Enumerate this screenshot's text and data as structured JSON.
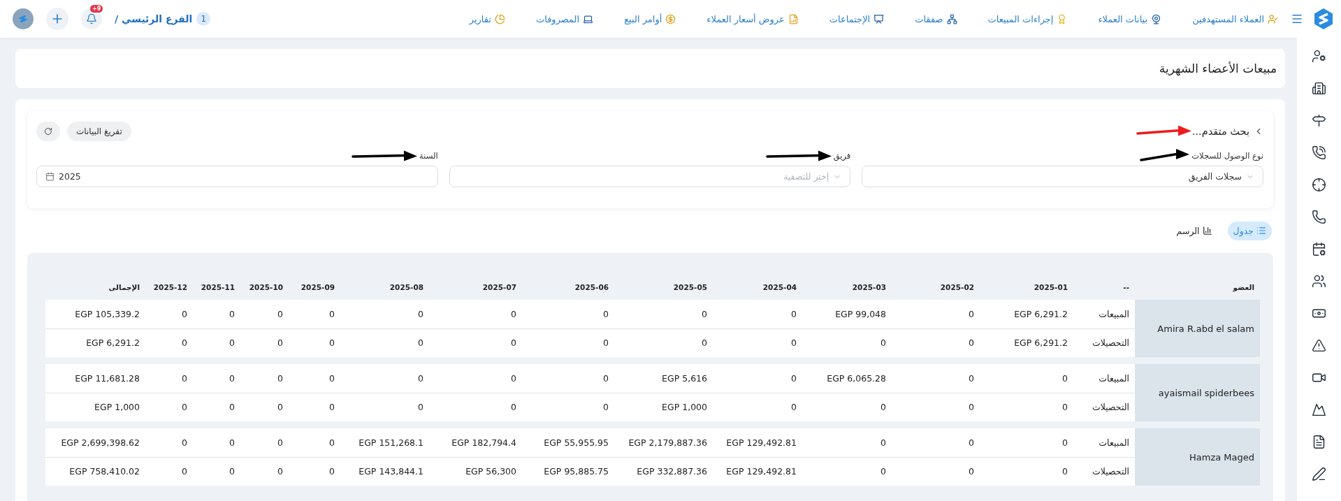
{
  "topbar": {
    "nav": [
      {
        "label": "العملاء المستهدفين"
      },
      {
        "label": "بيانات العملاء"
      },
      {
        "label": "إجراءات المبيعات"
      },
      {
        "label": "صفقات"
      },
      {
        "label": "الإجتماعات"
      },
      {
        "label": "عروض أسعار العملاء"
      },
      {
        "label": "أوامر البيع"
      },
      {
        "label": "المصروفات"
      },
      {
        "label": "تقارير"
      }
    ],
    "branch": {
      "number": "1",
      "name": "الفرع الرئيسي /"
    },
    "notifications": {
      "badge": "+9"
    }
  },
  "page_title": "مبيعات الأعضاء الشهرية",
  "filters": {
    "toggle_label": "بحث متقدم...",
    "toggle_arrow": {
      "color": "#ee1c1c"
    },
    "buttons": [
      {
        "kind": "text",
        "label": "تفريغ البيانات"
      },
      {
        "kind": "refresh"
      }
    ],
    "fields": [
      {
        "kind": "select",
        "label": "نوع الوصول للسجلات",
        "value": "سجلات الفريق",
        "arrow": {
          "color": "#000000"
        }
      },
      {
        "kind": "select",
        "label": "فريق",
        "placeholder": "إختر للتصفية",
        "arrow": {
          "color": "#000000"
        }
      },
      {
        "kind": "date",
        "label": "السنة",
        "value": "2025",
        "arrow": {
          "color": "#000000"
        }
      }
    ]
  },
  "views": [
    {
      "kind": "table",
      "label": "جدول",
      "selected": true
    },
    {
      "kind": "chart",
      "label": "الرسم",
      "selected": false
    }
  ],
  "table": {
    "columns": [
      "العضو",
      "--",
      "2025-01",
      "2025-02",
      "2025-03",
      "2025-04",
      "2025-05",
      "2025-06",
      "2025-07",
      "2025-08",
      "2025-09",
      "2025-10",
      "2025-11",
      "2025-12",
      "الإجمالى"
    ],
    "members": [
      {
        "name": "Amira R.abd el salam",
        "rows": [
          {
            "type": "المبيعات",
            "values": [
              "EGP 6,291.2",
              "0",
              "EGP 99,048",
              "0",
              "0",
              "0",
              "0",
              "0",
              "0",
              "0",
              "0",
              "0",
              "EGP 105,339.2"
            ]
          },
          {
            "type": "التحصيلات",
            "values": [
              "EGP 6,291.2",
              "0",
              "0",
              "0",
              "0",
              "0",
              "0",
              "0",
              "0",
              "0",
              "0",
              "0",
              "EGP 6,291.2"
            ]
          }
        ]
      },
      {
        "name": "ayaismail spiderbees",
        "rows": [
          {
            "type": "المبيعات",
            "values": [
              "0",
              "0",
              "EGP 6,065.28",
              "0",
              "EGP 5,616",
              "0",
              "0",
              "0",
              "0",
              "0",
              "0",
              "0",
              "EGP 11,681.28"
            ]
          },
          {
            "type": "التحصيلات",
            "values": [
              "0",
              "0",
              "0",
              "0",
              "EGP 1,000",
              "0",
              "0",
              "0",
              "0",
              "0",
              "0",
              "0",
              "EGP 1,000"
            ]
          }
        ]
      },
      {
        "name": "Hamza Maged",
        "rows": [
          {
            "type": "المبيعات",
            "values": [
              "0",
              "0",
              "0",
              "EGP 129,492.81",
              "EGP 2,179,887.36",
              "EGP 55,955.95",
              "EGP 182,794.4",
              "EGP 151,268.1",
              "0",
              "0",
              "0",
              "0",
              "EGP 2,699,398.62"
            ]
          },
          {
            "type": "التحصيلات",
            "values": [
              "0",
              "0",
              "0",
              "EGP 129,492.81",
              "EGP 332,887.36",
              "EGP 95,885.75",
              "EGP 56,300",
              "EGP 143,844.1",
              "0",
              "0",
              "0",
              "0",
              "EGP 758,410.02"
            ]
          }
        ]
      }
    ]
  }
}
